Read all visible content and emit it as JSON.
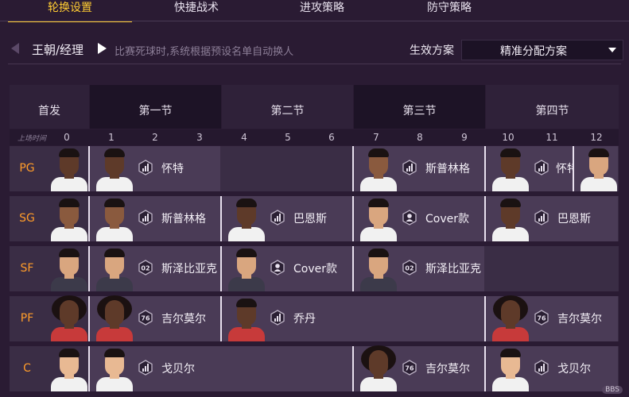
{
  "tabs": [
    {
      "label": "轮换设置",
      "active": true
    },
    {
      "label": "快捷战术",
      "active": false
    },
    {
      "label": "进攻策略",
      "active": false
    },
    {
      "label": "防守策略",
      "active": false
    }
  ],
  "subheader": {
    "gm_label": "王朝/经理",
    "hint": "比赛死球时,系统根据预设名单自动换人",
    "plan_label": "生效方案",
    "plan_value": "精准分配方案"
  },
  "grid": {
    "starter_header": "首发",
    "quarters": [
      "第一节",
      "第二节",
      "第三节",
      "第四节"
    ],
    "minutes_label": "上场时间",
    "minutes": [
      "0",
      "1",
      "2",
      "3",
      "4",
      "5",
      "6",
      "7",
      "8",
      "9",
      "10",
      "11",
      "12"
    ]
  },
  "rows": [
    {
      "pos": "PG",
      "slots": [
        {
          "name": "怀特",
          "tag": "chart",
          "color": "dark"
        },
        {
          "name": "斯普林格",
          "tag": "chart",
          "color": "mid"
        },
        {
          "name": "怀特",
          "tag": "chart",
          "color": "dark"
        },
        {
          "name": "",
          "tag": "",
          "color": "light"
        }
      ]
    },
    {
      "pos": "SG",
      "slots": [
        {
          "name": "斯普林格",
          "tag": "chart",
          "color": "mid"
        },
        {
          "name": "巴恩斯",
          "tag": "chart",
          "color": "dark"
        },
        {
          "name": "Cover款",
          "tag": "user",
          "color": "light"
        },
        {
          "name": "巴恩斯",
          "tag": "chart",
          "color": "dark"
        }
      ]
    },
    {
      "pos": "SF",
      "slots": [
        {
          "name": "斯泽比亚克",
          "tag": "02",
          "color": "light"
        },
        {
          "name": "Cover款",
          "tag": "user",
          "color": "light"
        },
        {
          "name": "斯泽比亚克",
          "tag": "02",
          "color": "light"
        }
      ]
    },
    {
      "pos": "PF",
      "slots": [
        {
          "name": "吉尔莫尔",
          "tag": "76",
          "color": "dark"
        },
        {
          "name": "乔丹",
          "tag": "chart",
          "color": "dark"
        },
        {
          "name": "吉尔莫尔",
          "tag": "76",
          "color": "dark"
        }
      ]
    },
    {
      "pos": "C",
      "slots": [
        {
          "name": "戈贝尔",
          "tag": "chart",
          "color": "pale"
        },
        {
          "name": "吉尔莫尔",
          "tag": "76",
          "color": "dark"
        },
        {
          "name": "戈贝尔",
          "tag": "chart",
          "color": "pale"
        }
      ]
    }
  ],
  "watermark": "BBS",
  "colors": {
    "accent": "#ffcc33",
    "position": "#ff9c2a",
    "background": "#2a1b33"
  }
}
